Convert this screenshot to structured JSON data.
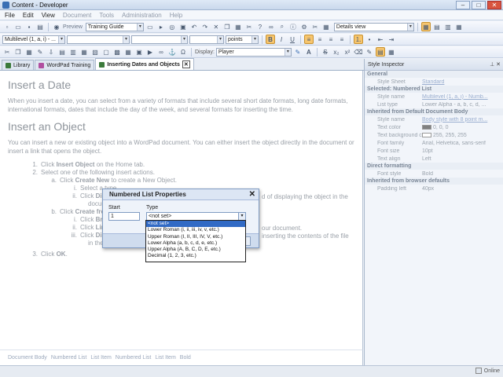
{
  "window": {
    "title": "Content - Developer"
  },
  "menu": [
    "File",
    "Edit",
    "View",
    "Document",
    "Tools",
    "Administration",
    "Help"
  ],
  "menu_disabled": [
    "Document",
    "Tools",
    "Administration",
    "Help"
  ],
  "toolbar1": {
    "preview_label": "Preview",
    "project_value": "Training Guide",
    "view_value": "Details view"
  },
  "toolbar2": {
    "list_style_value": "Multilevel (1, a, i) - ...",
    "units_value": "points"
  },
  "toolbar3": {
    "display_label": "Display:",
    "display_value": "Player"
  },
  "tabs": [
    {
      "label": "Library",
      "color": "#3b7a3b"
    },
    {
      "label": "WordPad Training",
      "color": "#b14fa0"
    },
    {
      "label": "Inserting Dates and Objects",
      "color": "#3b7a3b"
    }
  ],
  "document": {
    "h1": "Insert a Date",
    "p1": "When you insert a date, you can select from a variety of formats that include several short date formats, long date formats, international formats, dates that include the day of the week, and several formats for inserting the time.",
    "h2": "Insert an Object",
    "p2": "You can insert a new or existing object into a WordPad document. You can either insert the object directly in the document or insert a link that opens the object.",
    "list": [
      {
        "n": "1.",
        "pre": "Click ",
        "b": "Insert Object",
        "post": " on the Home tab."
      },
      {
        "n": "2.",
        "pre": "Select one of the following insert actions.",
        "b": "",
        "post": ""
      },
      {
        "n": "a.",
        "pre": "Click ",
        "b": "Create New",
        "post": " to create a New Object."
      },
      {
        "n": "i.",
        "pre": "Select a type",
        "b": "",
        "post": ""
      },
      {
        "n": "ii.",
        "pre": "Click ",
        "b": "Displa",
        "post": ""
      },
      {
        "n": "",
        "pre": "document.",
        "b": "",
        "post": ""
      },
      {
        "n": "b.",
        "pre": "Click ",
        "b": "Create from F",
        "post": ""
      },
      {
        "n": "i.",
        "pre": "Click ",
        "b": "Brows",
        "post": ""
      },
      {
        "n": "ii.",
        "pre": "Click ",
        "b": "Link",
        "post": " if"
      },
      {
        "n": "iii.",
        "pre": "Click ",
        "b": "Display",
        "post": ""
      },
      {
        "n": "",
        "pre": "in the docum",
        "b": "",
        "post": ""
      },
      {
        "n": "3.",
        "pre": "Click ",
        "b": "OK",
        "post": "."
      }
    ],
    "right_fragments": [
      "d of displaying the object in the",
      "our document.",
      "inserting the contents of the file"
    ]
  },
  "breadcrumb": [
    "Document Body",
    "Numbered List",
    "List Item",
    "Numbered List",
    "List Item",
    "Bold"
  ],
  "inspector": {
    "title": "Style Inspector",
    "sections": [
      {
        "title": "General",
        "rows": [
          {
            "k": "Style Sheet",
            "v": "Standard",
            "link": true
          }
        ]
      },
      {
        "title": "Selected: Numbered List",
        "rows": [
          {
            "k": "Style name",
            "v": "Multilevel (1, a, i) - Numb...",
            "link": true
          },
          {
            "k": "List type",
            "v": "Lower Alpha - a, b, c, d, ...",
            "link": false
          }
        ]
      },
      {
        "title": "Inherited from Default Document Body",
        "rows": [
          {
            "k": "Style name",
            "v": "Body style with 8 point m...",
            "link": true
          },
          {
            "k": "Text color",
            "v": "0, 0, 0",
            "link": false,
            "swatch": "#808080"
          },
          {
            "k": "Text background color",
            "v": "255, 255, 255",
            "link": false,
            "swatch": "#ffffff"
          },
          {
            "k": "Font family",
            "v": "Arial, Helvetica, sans-serif",
            "link": false
          },
          {
            "k": "Font size",
            "v": "10pt",
            "link": false
          },
          {
            "k": "Text align",
            "v": "Left",
            "link": false
          }
        ]
      },
      {
        "title": "Direct formatting",
        "rows": [
          {
            "k": "Font style",
            "v": "Bold",
            "link": false
          }
        ]
      },
      {
        "title": "Inherited from browser defaults",
        "rows": [
          {
            "k": "Padding left",
            "v": "40px",
            "link": false
          }
        ]
      }
    ]
  },
  "status": {
    "online": "Online"
  },
  "dialog": {
    "title": "Numbered List Properties",
    "start_label": "Start",
    "start_value": "1",
    "type_label": "Type",
    "type_value": "<not set>",
    "options": [
      "<not set>",
      "Lower Roman (i, ii, iii, iv, v, etc.)",
      "Upper Roman (I, II, III, IV, V, etc.)",
      "Lower Alpha (a, b, c, d, e, etc.)",
      "Upper Alpha (A, B, C, D, E, etc.)",
      "Decimal (1, 2, 3, etc.)"
    ]
  }
}
